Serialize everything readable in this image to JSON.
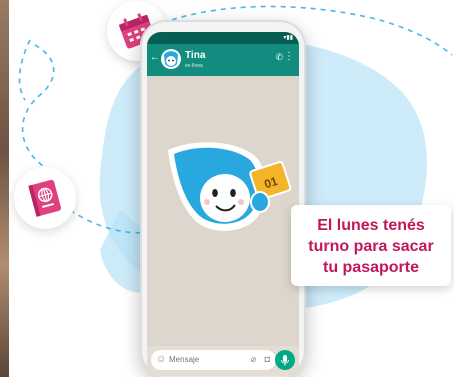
{
  "chat": {
    "contact_name": "Tina",
    "contact_status": "en línea",
    "input_placeholder": "Mensaje"
  },
  "sticker": {
    "ticket_number": "01"
  },
  "callout": {
    "lines": [
      "El lunes tenés",
      "turno para sacar",
      "tu pasaporte"
    ]
  },
  "colors": {
    "brand_pink": "#e0407f",
    "whatsapp_dark": "#075e54",
    "whatsapp_green": "#128c7e",
    "send_green": "#00a884",
    "tina_blue": "#29a8e0",
    "ticket_yellow": "#f4b52a"
  },
  "icons": [
    "calendar-icon",
    "passport-icon",
    "call-icon",
    "more-icon",
    "emoji-icon",
    "attach-icon",
    "camera-icon",
    "mic-icon"
  ]
}
